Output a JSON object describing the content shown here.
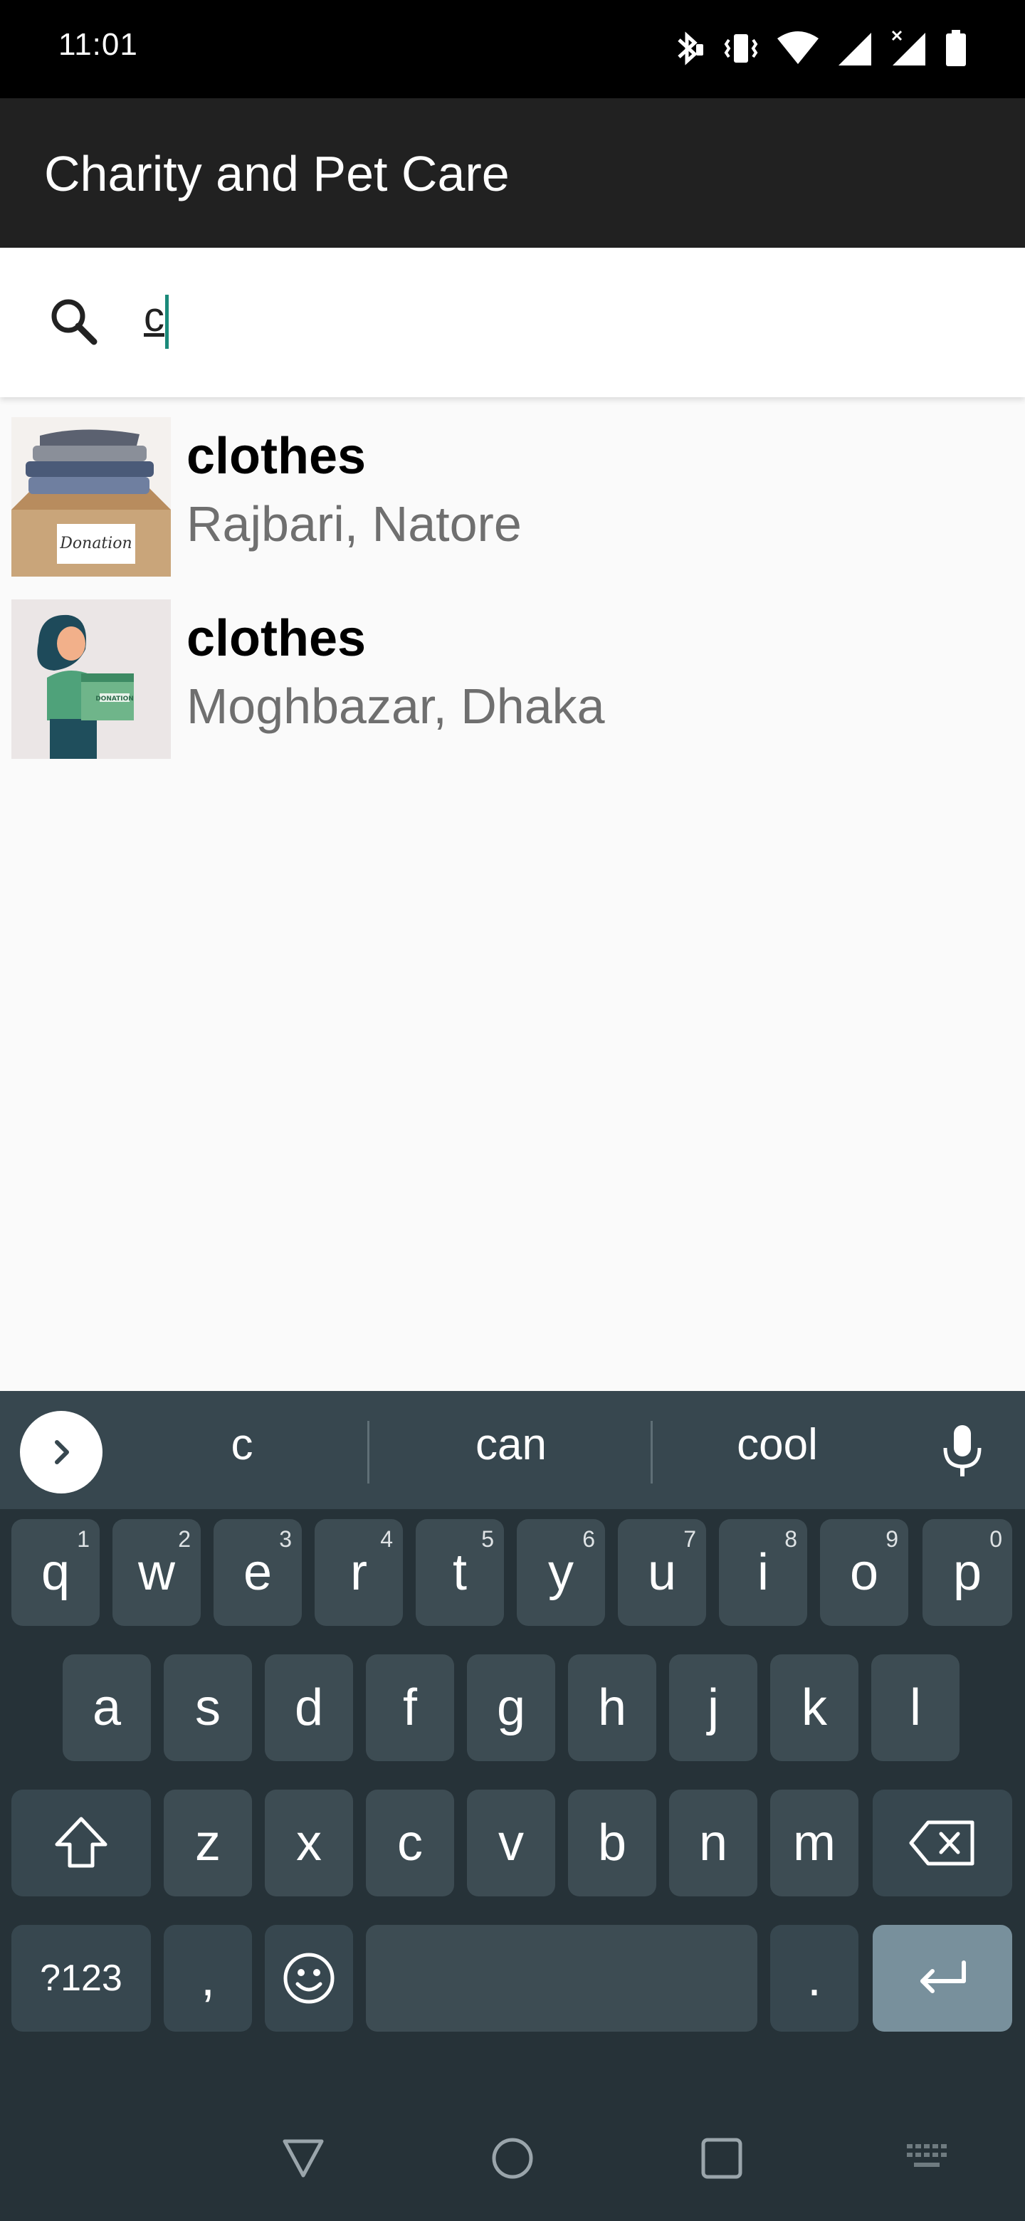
{
  "status_bar": {
    "time": "11:01",
    "icons": [
      "bluetooth-icon",
      "vibrate-icon",
      "wifi-icon",
      "signal-icon",
      "signal-no-data-icon",
      "battery-icon"
    ]
  },
  "app_bar": {
    "title": "Charity and Pet Care"
  },
  "search": {
    "value": "c",
    "icon": "search-icon"
  },
  "results": [
    {
      "title": "clothes",
      "subtitle": "Rajbari, Natore",
      "image": "donation-box-thumbnail"
    },
    {
      "title": "clothes",
      "subtitle": "Moghbazar, Dhaka",
      "image": "woman-donation-box-thumbnail"
    }
  ],
  "keyboard": {
    "suggestions": [
      "c",
      "can",
      "cool"
    ],
    "row1": [
      {
        "key": "q",
        "hint": "1"
      },
      {
        "key": "w",
        "hint": "2"
      },
      {
        "key": "e",
        "hint": "3"
      },
      {
        "key": "r",
        "hint": "4"
      },
      {
        "key": "t",
        "hint": "5"
      },
      {
        "key": "y",
        "hint": "6"
      },
      {
        "key": "u",
        "hint": "7"
      },
      {
        "key": "i",
        "hint": "8"
      },
      {
        "key": "o",
        "hint": "9"
      },
      {
        "key": "p",
        "hint": "0"
      }
    ],
    "row2": [
      "a",
      "s",
      "d",
      "f",
      "g",
      "h",
      "j",
      "k",
      "l"
    ],
    "row3": [
      "z",
      "x",
      "c",
      "v",
      "b",
      "n",
      "m"
    ],
    "symbols_label": "?123",
    "comma_label": ",",
    "period_label": "."
  },
  "colors": {
    "app_bar": "#212121",
    "keyboard_bg": "#263238",
    "key_bg": "#3d4c53",
    "enter_key": "#78909c",
    "cursor": "#1b8a7a"
  }
}
